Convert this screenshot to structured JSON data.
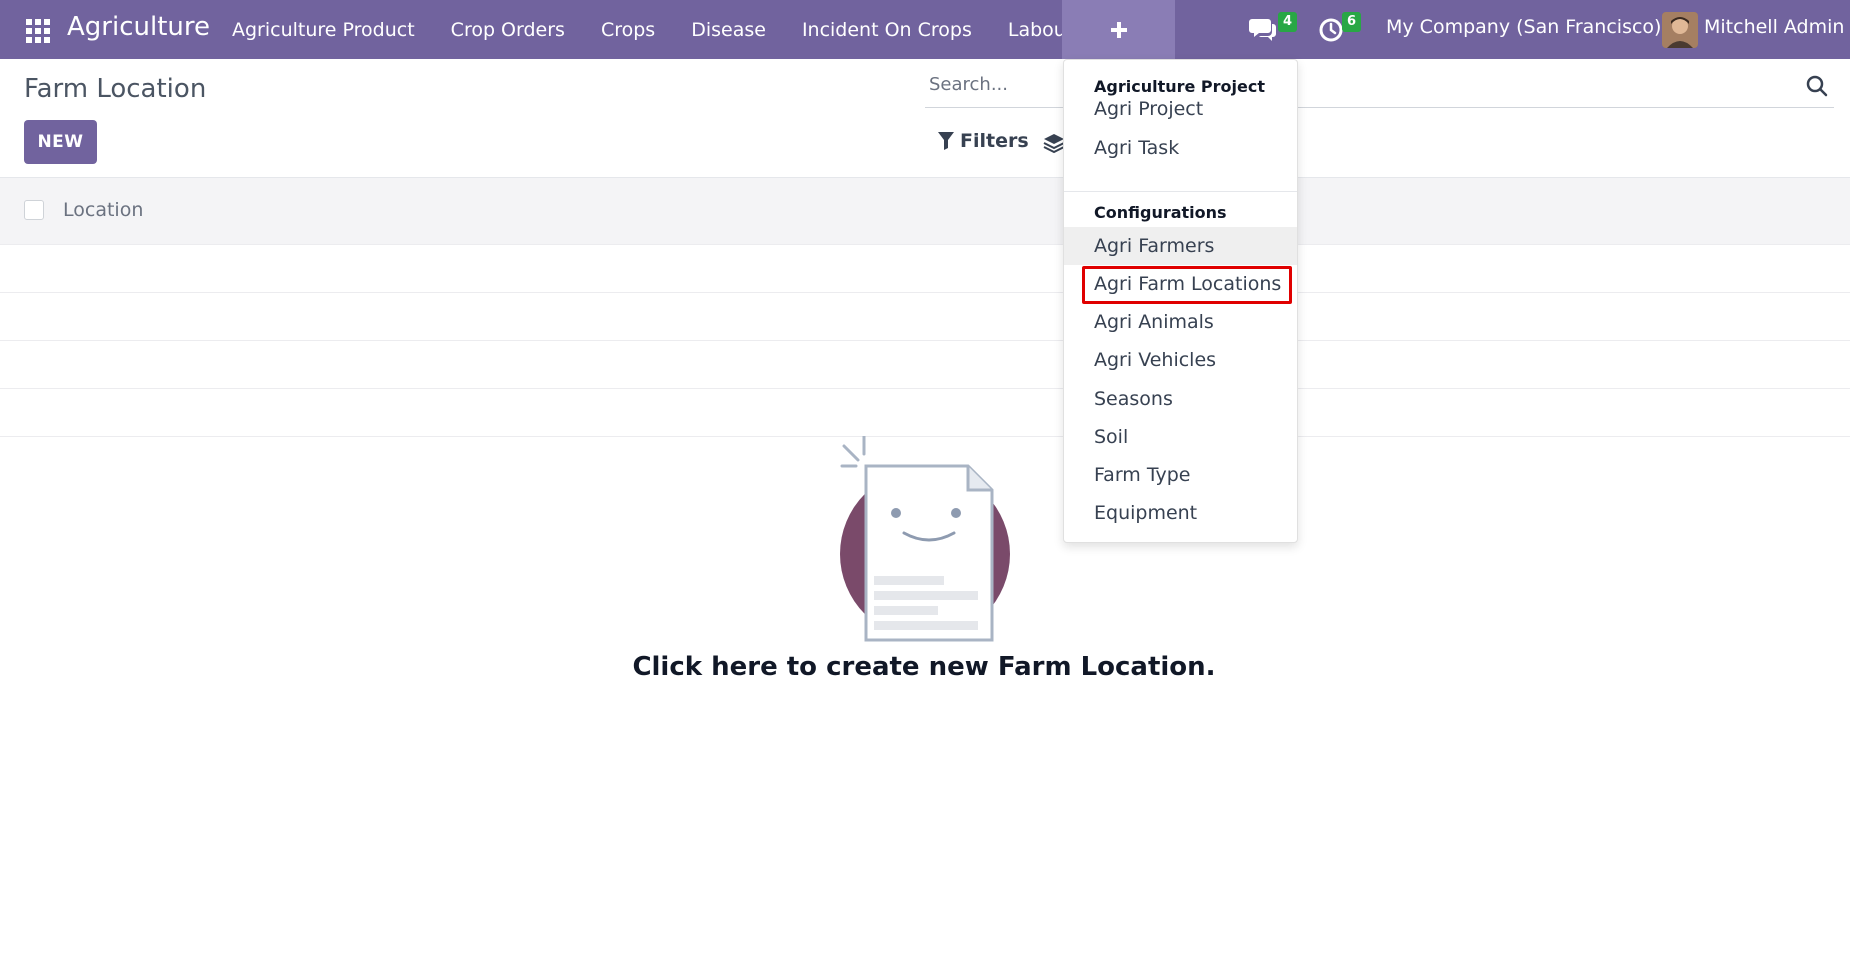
{
  "navbar": {
    "brand": "Agriculture",
    "menu": [
      "Agriculture Product",
      "Crop Orders",
      "Crops",
      "Disease",
      "Incident On Crops",
      "Labours"
    ],
    "messages_count": "4",
    "activities_count": "6",
    "company": "My Company (San Francisco)",
    "user": "Mitchell Admin"
  },
  "control_panel": {
    "title": "Farm Location",
    "new_label": "NEW",
    "search_placeholder": "Search...",
    "filters_label": "Filters"
  },
  "list": {
    "columns": [
      "Location"
    ]
  },
  "empty_state": {
    "message": "Click here to create new Farm Location."
  },
  "dropdown": {
    "section1": {
      "header": "Agriculture Project",
      "items": [
        "Agri Project",
        "Agri Task"
      ]
    },
    "section2": {
      "header": "Configurations",
      "items": [
        "Agri Farmers",
        "Agri Farm Locations",
        "Agri Animals",
        "Agri Vehicles",
        "Seasons",
        "Soil",
        "Farm Type",
        "Equipment"
      ]
    }
  },
  "colors": {
    "brand": "#71639e",
    "highlight": "#e00000",
    "badge": "#28a745"
  }
}
